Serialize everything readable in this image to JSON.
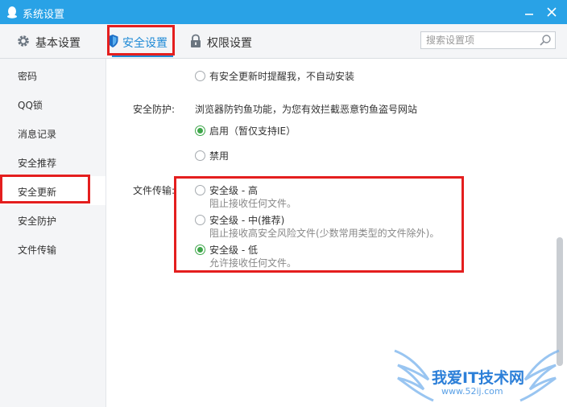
{
  "window": {
    "title": "系统设置",
    "icon": "penguin-icon"
  },
  "tabs": [
    {
      "label": "基本设置",
      "icon": "gear-icon"
    },
    {
      "label": "安全设置",
      "icon": "shield-icon",
      "active": true
    },
    {
      "label": "权限设置",
      "icon": "lock-icon"
    }
  ],
  "search": {
    "placeholder": "搜索设置项"
  },
  "sidebar": {
    "items": [
      {
        "label": "密码"
      },
      {
        "label": "QQ锁"
      },
      {
        "label": "消息记录"
      },
      {
        "label": "安全推荐"
      },
      {
        "label": "安全更新",
        "active": true
      },
      {
        "label": "安全防护"
      },
      {
        "label": "文件传输"
      }
    ]
  },
  "main": {
    "update_option": {
      "label": "有安全更新时提醒我，不自动安装",
      "checked": false
    },
    "protection": {
      "label": "安全防护:",
      "description": "浏览器防钓鱼功能，为您有效拦截恶意钓鱼盗号网站",
      "options": [
        {
          "label": "启用（暂仅支持IE）",
          "checked": true
        },
        {
          "label": "禁用",
          "checked": false
        }
      ]
    },
    "file_transfer": {
      "label": "文件传输:",
      "options": [
        {
          "label": "安全级 - 高",
          "sub": "阻止接收任何文件。",
          "checked": false
        },
        {
          "label": "安全级 - 中(推荐)",
          "sub": "阻止接收高安全风险文件(少数常用类型的文件除外)。",
          "checked": false
        },
        {
          "label": "安全级 - 低",
          "sub": "允许接收任何文件。",
          "checked": true
        }
      ]
    }
  },
  "watermark": {
    "title": "我爱IT技术网",
    "url": "www.52ij.com"
  },
  "colors": {
    "titlebar": "#29a2e6",
    "accent": "#1f8ad6",
    "radio_checked": "#3ea64a",
    "highlight": "#e41e1e"
  }
}
